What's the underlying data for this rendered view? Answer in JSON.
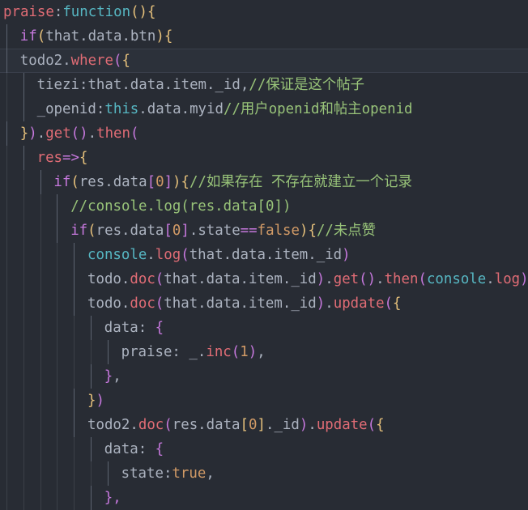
{
  "editor": {
    "lines": [
      {
        "indent": 0,
        "tokens": [
          [
            "praise",
            "c-red"
          ],
          [
            ":",
            "c-punc"
          ],
          [
            "function",
            "c-cyan"
          ],
          [
            "(){",
            "c-yellow"
          ]
        ]
      },
      {
        "indent": 1,
        "tokens": [
          [
            "if",
            "c-purple"
          ],
          [
            "(",
            "c-yellow"
          ],
          [
            "that.data.btn",
            "c-ident"
          ],
          [
            "){",
            "c-yellow"
          ]
        ]
      },
      {
        "indent": 1,
        "current": true,
        "tokens": [
          [
            "todo2",
            "c-ident"
          ],
          [
            ".",
            "c-punc"
          ],
          [
            "where",
            "c-red"
          ],
          [
            "(",
            "c-purple"
          ],
          [
            "{",
            "c-yellow"
          ]
        ]
      },
      {
        "indent": 2,
        "tokens": [
          [
            "tiezi",
            "c-ident"
          ],
          [
            ":",
            "c-punc"
          ],
          [
            "that.data.item._id",
            "c-ident"
          ],
          [
            ",",
            "c-punc"
          ],
          [
            "//保证是这个帖子",
            "c-green"
          ]
        ]
      },
      {
        "indent": 2,
        "tokens": [
          [
            "_openid",
            "c-ident"
          ],
          [
            ":",
            "c-punc"
          ],
          [
            "this",
            "c-cyan"
          ],
          [
            ".data.myid",
            "c-ident"
          ],
          [
            "//用户openid和帖主openid",
            "c-green"
          ]
        ]
      },
      {
        "indent": 1,
        "tokens": [
          [
            "}",
            "c-yellow"
          ],
          [
            ")",
            "c-purple"
          ],
          [
            ".",
            "c-punc"
          ],
          [
            "get",
            "c-red"
          ],
          [
            "()",
            "c-purple"
          ],
          [
            ".",
            "c-punc"
          ],
          [
            "then",
            "c-red"
          ],
          [
            "(",
            "c-purple"
          ]
        ]
      },
      {
        "indent": 2,
        "tokens": [
          [
            "res",
            "c-red"
          ],
          [
            "=>",
            "c-purple"
          ],
          [
            "{",
            "c-yellow"
          ]
        ]
      },
      {
        "indent": 3,
        "tokens": [
          [
            "if",
            "c-purple"
          ],
          [
            "(",
            "c-yellow"
          ],
          [
            "res.data",
            "c-ident"
          ],
          [
            "[",
            "c-purple"
          ],
          [
            "0",
            "c-orange"
          ],
          [
            "]",
            "c-purple"
          ],
          [
            ")",
            "c-yellow"
          ],
          [
            "{",
            "c-yellow"
          ],
          [
            "//如果存在 不存在就建立一个记录",
            "c-green"
          ]
        ]
      },
      {
        "indent": 4,
        "tokens": [
          [
            "//console.log(res.data[0])",
            "c-green"
          ]
        ]
      },
      {
        "indent": 4,
        "tokens": [
          [
            "if",
            "c-purple"
          ],
          [
            "(",
            "c-yellow"
          ],
          [
            "res.data",
            "c-ident"
          ],
          [
            "[",
            "c-purple"
          ],
          [
            "0",
            "c-orange"
          ],
          [
            "]",
            "c-purple"
          ],
          [
            ".state",
            "c-ident"
          ],
          [
            "==",
            "c-purple"
          ],
          [
            "false",
            "c-orange"
          ],
          [
            ")",
            "c-yellow"
          ],
          [
            "{",
            "c-yellow"
          ],
          [
            "//未点赞",
            "c-green"
          ]
        ]
      },
      {
        "indent": 5,
        "tokens": [
          [
            "console",
            "c-cyan"
          ],
          [
            ".",
            "c-punc"
          ],
          [
            "log",
            "c-red"
          ],
          [
            "(",
            "c-purple"
          ],
          [
            "that.data.item._id",
            "c-ident"
          ],
          [
            ")",
            "c-purple"
          ]
        ]
      },
      {
        "indent": 5,
        "tokens": [
          [
            "todo",
            "c-ident"
          ],
          [
            ".",
            "c-punc"
          ],
          [
            "doc",
            "c-red"
          ],
          [
            "(",
            "c-purple"
          ],
          [
            "that.data.item._id",
            "c-ident"
          ],
          [
            ")",
            "c-purple"
          ],
          [
            ".",
            "c-punc"
          ],
          [
            "get",
            "c-red"
          ],
          [
            "()",
            "c-purple"
          ],
          [
            ".",
            "c-punc"
          ],
          [
            "then",
            "c-red"
          ],
          [
            "(",
            "c-purple"
          ],
          [
            "console",
            "c-cyan"
          ],
          [
            ".",
            "c-punc"
          ],
          [
            "log",
            "c-red"
          ],
          [
            ")",
            "c-purple"
          ]
        ]
      },
      {
        "indent": 5,
        "tokens": [
          [
            "todo",
            "c-ident"
          ],
          [
            ".",
            "c-punc"
          ],
          [
            "doc",
            "c-red"
          ],
          [
            "(",
            "c-purple"
          ],
          [
            "that.data.item._id",
            "c-ident"
          ],
          [
            ")",
            "c-purple"
          ],
          [
            ".",
            "c-punc"
          ],
          [
            "update",
            "c-red"
          ],
          [
            "(",
            "c-purple"
          ],
          [
            "{",
            "c-yellow"
          ]
        ]
      },
      {
        "indent": 6,
        "tokens": [
          [
            "data",
            "c-ident"
          ],
          [
            ": ",
            "c-punc"
          ],
          [
            "{",
            "c-purple"
          ]
        ]
      },
      {
        "indent": 7,
        "tokens": [
          [
            "praise",
            "c-ident"
          ],
          [
            ": ",
            "c-punc"
          ],
          [
            "_",
            "c-ident"
          ],
          [
            ".",
            "c-punc"
          ],
          [
            "inc",
            "c-red"
          ],
          [
            "(",
            "c-purple"
          ],
          [
            "1",
            "c-orange"
          ],
          [
            ")",
            "c-purple"
          ],
          [
            ",",
            "c-punc"
          ]
        ]
      },
      {
        "indent": 6,
        "tokens": [
          [
            "}",
            "c-purple"
          ],
          [
            ",",
            "c-punc"
          ]
        ]
      },
      {
        "indent": 5,
        "tokens": [
          [
            "}",
            "c-yellow"
          ],
          [
            ")",
            "c-purple"
          ]
        ]
      },
      {
        "indent": 5,
        "tokens": [
          [
            "todo2",
            "c-ident"
          ],
          [
            ".",
            "c-punc"
          ],
          [
            "doc",
            "c-red"
          ],
          [
            "(",
            "c-purple"
          ],
          [
            "res.data",
            "c-ident"
          ],
          [
            "[",
            "c-yellow"
          ],
          [
            "0",
            "c-orange"
          ],
          [
            "]",
            "c-yellow"
          ],
          [
            "._id",
            "c-ident"
          ],
          [
            ")",
            "c-purple"
          ],
          [
            ".",
            "c-punc"
          ],
          [
            "update",
            "c-red"
          ],
          [
            "(",
            "c-purple"
          ],
          [
            "{",
            "c-yellow"
          ]
        ]
      },
      {
        "indent": 6,
        "tokens": [
          [
            "data",
            "c-ident"
          ],
          [
            ": ",
            "c-punc"
          ],
          [
            "{",
            "c-purple"
          ]
        ]
      },
      {
        "indent": 7,
        "tokens": [
          [
            "state",
            "c-ident"
          ],
          [
            ":",
            "c-punc"
          ],
          [
            "true",
            "c-orange"
          ],
          [
            ",",
            "c-punc"
          ]
        ]
      },
      {
        "indent": 6,
        "tokens": [
          [
            "},",
            "c-purple"
          ]
        ]
      }
    ]
  }
}
